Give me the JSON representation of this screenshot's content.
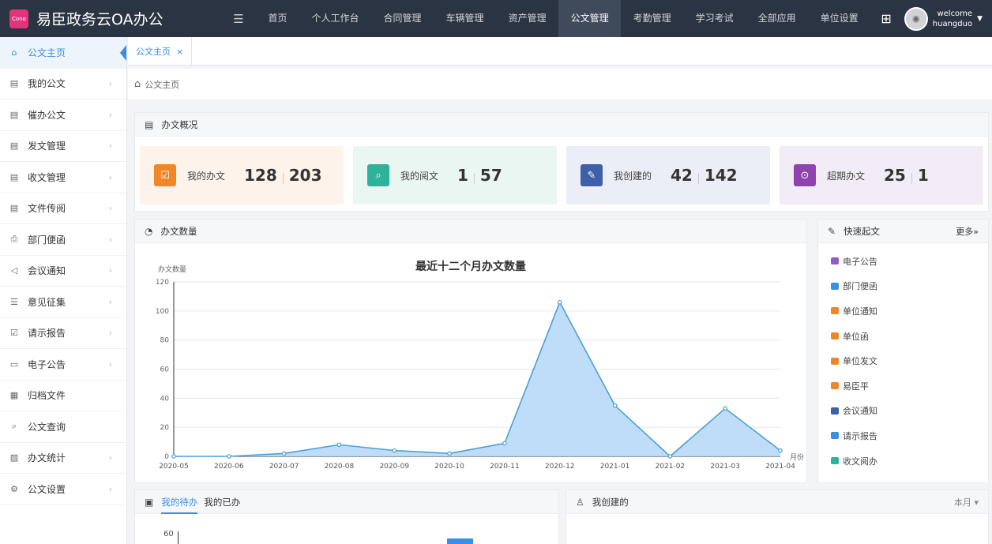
{
  "app": {
    "title": "易臣政务云OA办公",
    "logo_text": "Cono"
  },
  "nav": {
    "toggle_icon": "menu-toggle-icon",
    "items": [
      {
        "label": "首页"
      },
      {
        "label": "个人工作台"
      },
      {
        "label": "合同管理"
      },
      {
        "label": "车辆管理"
      },
      {
        "label": "资产管理"
      },
      {
        "label": "公文管理",
        "active": true
      },
      {
        "label": "考勤管理"
      },
      {
        "label": "学习考试"
      },
      {
        "label": "全部应用"
      },
      {
        "label": "单位设置"
      }
    ]
  },
  "user": {
    "welcome": "welcome",
    "name": "huangduo"
  },
  "sidebar": {
    "items": [
      {
        "label": "公文主页",
        "icon": "home-icon",
        "active": true
      },
      {
        "label": "我的公文",
        "icon": "doc-icon",
        "arrow": true
      },
      {
        "label": "催办公文",
        "icon": "doc-icon",
        "arrow": true
      },
      {
        "label": "发文管理",
        "icon": "doc-icon",
        "arrow": true
      },
      {
        "label": "收文管理",
        "icon": "doc-icon",
        "arrow": true
      },
      {
        "label": "文件传阅",
        "icon": "doc-icon",
        "arrow": true
      },
      {
        "label": "部门便函",
        "icon": "print-icon",
        "arrow": true
      },
      {
        "label": "会议通知",
        "icon": "speaker-icon",
        "arrow": true
      },
      {
        "label": "意见征集",
        "icon": "form-icon",
        "arrow": true
      },
      {
        "label": "请示报告",
        "icon": "report-icon",
        "arrow": true
      },
      {
        "label": "电子公告",
        "icon": "notice-icon",
        "arrow": true
      },
      {
        "label": "归档文件",
        "icon": "archive-icon",
        "arrow": false
      },
      {
        "label": "公文查询",
        "icon": "search-doc-icon",
        "arrow": false
      },
      {
        "label": "办文统计",
        "icon": "stats-icon",
        "arrow": true
      },
      {
        "label": "公文设置",
        "icon": "gear-icon",
        "arrow": true
      }
    ]
  },
  "tab": {
    "label": "公文主页",
    "close": "×"
  },
  "breadcrumb": {
    "label": "公文主页"
  },
  "overview": {
    "title": "办文概况",
    "cards": [
      {
        "label": "我的办文",
        "a": "128",
        "b": "203",
        "bg": "#fdf3ea",
        "color": "#f0862a"
      },
      {
        "label": "我的阅文",
        "a": "1",
        "b": "57",
        "bg": "#eaf6f1",
        "color": "#2fb29a"
      },
      {
        "label": "我创建的",
        "a": "42",
        "b": "142",
        "bg": "#eceef7",
        "color": "#3f5fa8"
      },
      {
        "label": "超期办文",
        "a": "25",
        "b": "1",
        "bg": "#f2ecf6",
        "color": "#8e44ad"
      }
    ]
  },
  "docs_chart": {
    "panel_title": "办文数量"
  },
  "chart_data": {
    "type": "area",
    "title": "最近十二个月办文数量",
    "ylabel": "办文数量",
    "xlabel": "月份",
    "x": [
      "2020-05",
      "2020-06",
      "2020-07",
      "2020-08",
      "2020-09",
      "2020-10",
      "2020-11",
      "2020-12",
      "2021-01",
      "2021-02",
      "2021-03",
      "2021-04"
    ],
    "values": [
      0,
      0,
      2,
      8,
      4,
      2,
      9,
      106,
      35,
      0,
      33,
      4
    ],
    "ylim": [
      0,
      120
    ],
    "yticks": [
      0,
      20,
      40,
      60,
      80,
      100,
      120
    ],
    "grid": true,
    "line_color": "#4a9fd8",
    "fill_color": "#b8d9f7"
  },
  "quick": {
    "title": "快速起文",
    "more": "更多»",
    "items": [
      {
        "label": "电子公告",
        "color": "#8e5cc4"
      },
      {
        "label": "部门便函",
        "color": "#3a8ee6"
      },
      {
        "label": "单位通知",
        "color": "#f0862a"
      },
      {
        "label": "单位函",
        "color": "#f0862a"
      },
      {
        "label": "单位发文",
        "color": "#f0862a"
      },
      {
        "label": "易臣平",
        "color": "#f0862a"
      },
      {
        "label": "会议通知",
        "color": "#3f5fa8"
      },
      {
        "label": "请示报告",
        "color": "#3a8ee6"
      },
      {
        "label": "收文阅办",
        "color": "#2fb29a"
      }
    ]
  },
  "todo": {
    "tab_active": "我的待办",
    "tab_other": "我的已办",
    "y_top": "60"
  },
  "created": {
    "title": "我创建的",
    "filter": "本月 ▾"
  }
}
